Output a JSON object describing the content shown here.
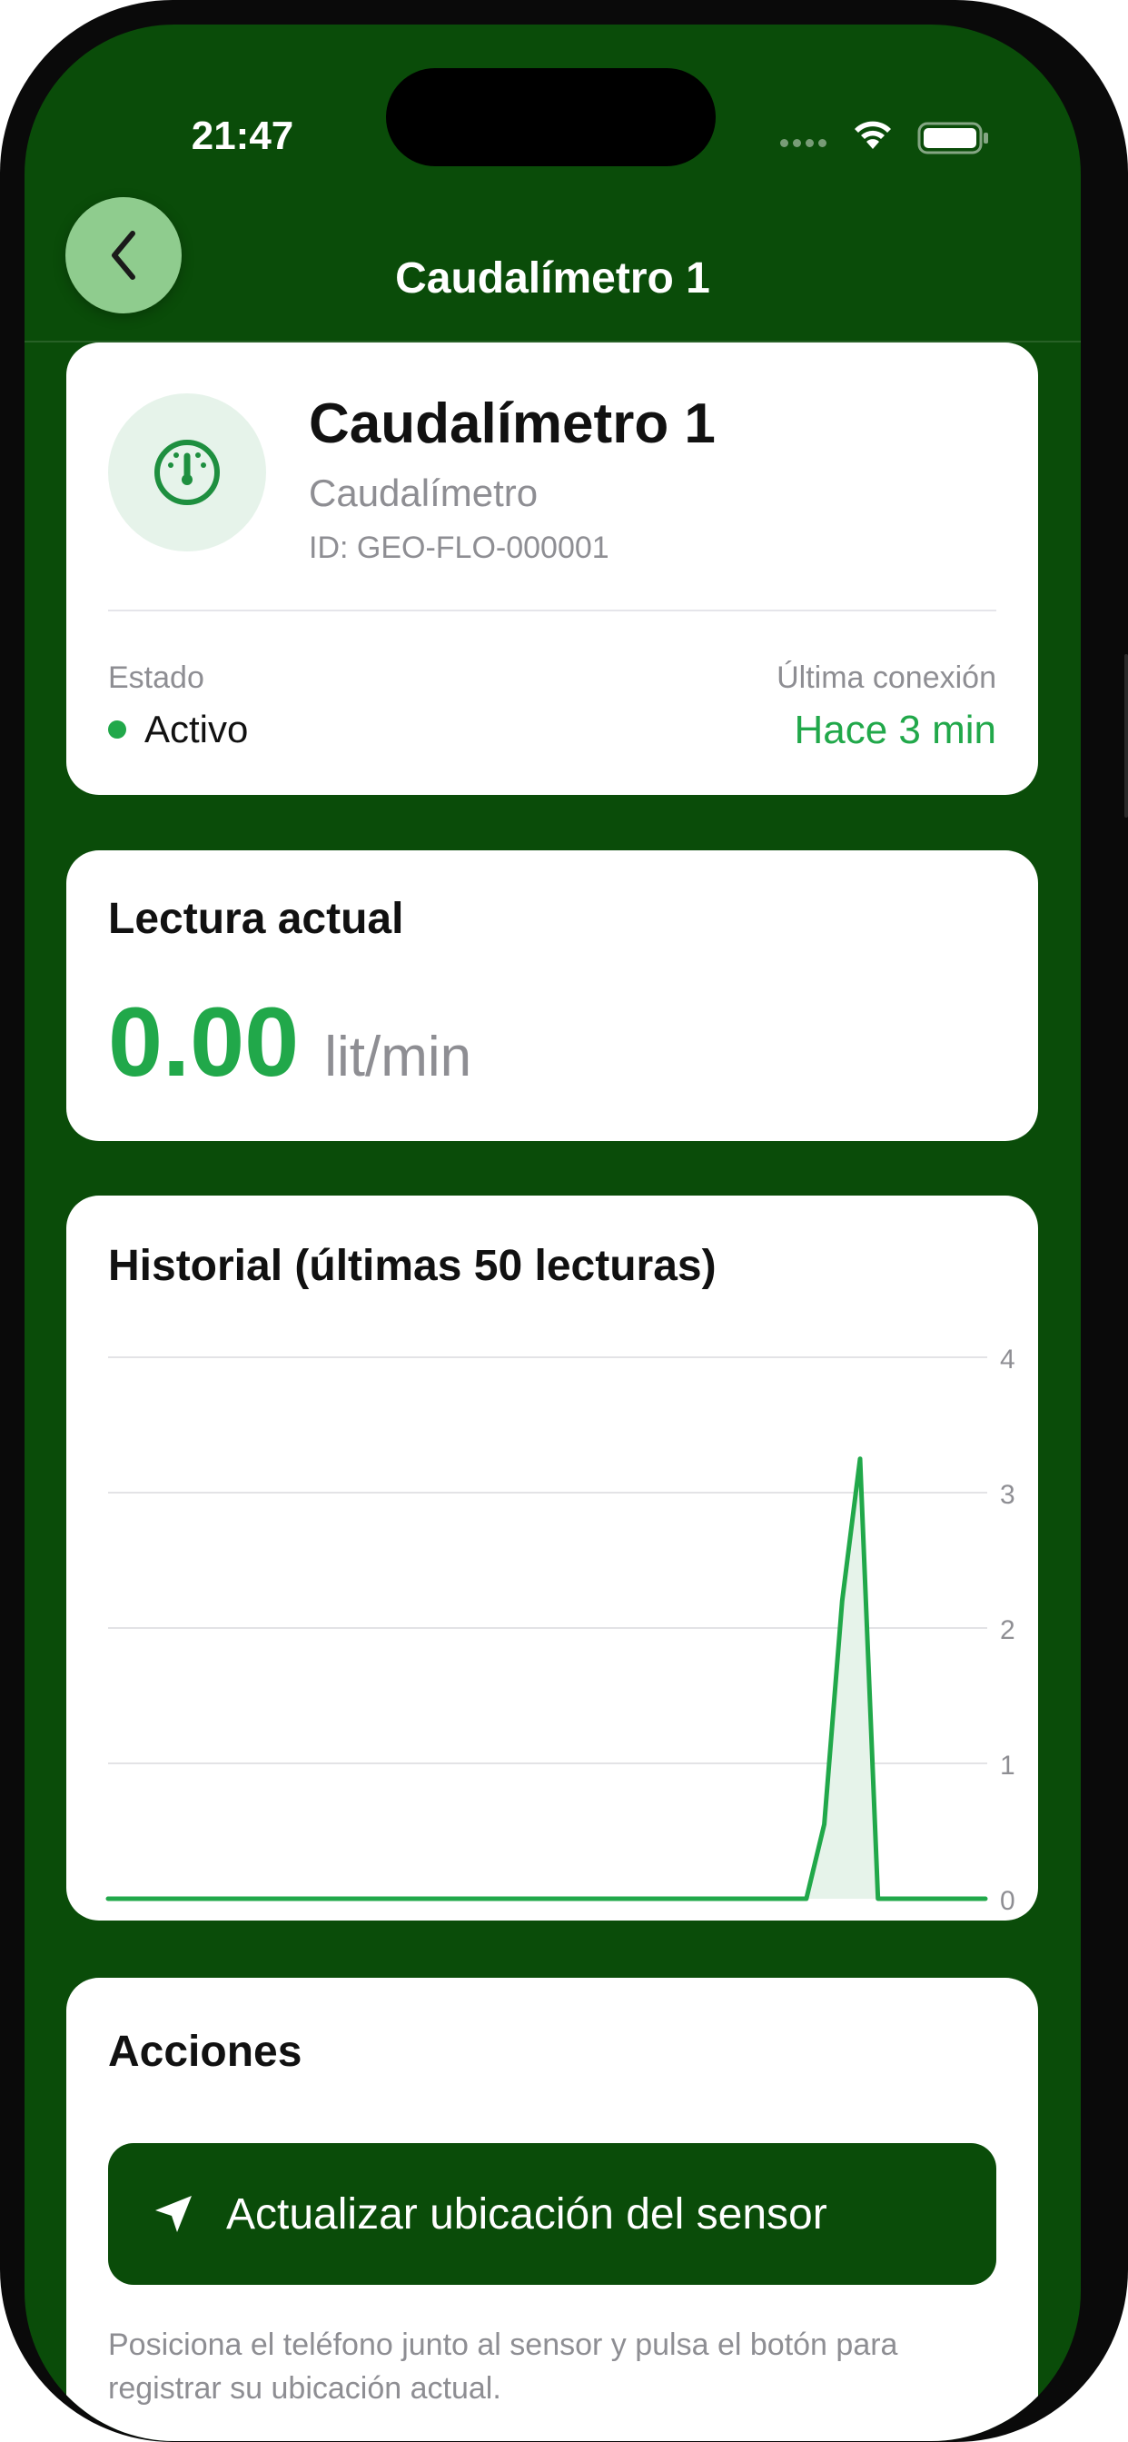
{
  "status_bar": {
    "time": "21:47"
  },
  "nav": {
    "title": "Caudalímetro 1",
    "back_icon": "chevron-left-icon"
  },
  "sensor": {
    "name": "Caudalímetro 1",
    "type": "Caudalímetro",
    "id": "ID: GEO-FLO-000001",
    "icon": "gauge-icon",
    "status_label": "Estado",
    "status_value": "Activo",
    "status_color": "#21a84a",
    "last_conn_label": "Última conexión",
    "last_conn_value": "Hace 3 min"
  },
  "reading": {
    "title": "Lectura actual",
    "value": "0.00",
    "unit": "lit/min"
  },
  "history": {
    "title": "Historial (últimas 50 lecturas)"
  },
  "chart_data": {
    "type": "area",
    "x": [
      1,
      2,
      3,
      4,
      5,
      6,
      7,
      8,
      9,
      10,
      11,
      12,
      13,
      14,
      15,
      16,
      17,
      18,
      19,
      20,
      21,
      22,
      23,
      24,
      25,
      26,
      27,
      28,
      29,
      30,
      31,
      32,
      33,
      34,
      35,
      36,
      37,
      38,
      39,
      40,
      41,
      42,
      43,
      44,
      45,
      46,
      47,
      48,
      49,
      50
    ],
    "values": [
      0,
      0,
      0,
      0,
      0,
      0,
      0,
      0,
      0,
      0,
      0,
      0,
      0,
      0,
      0,
      0,
      0,
      0,
      0,
      0,
      0,
      0,
      0,
      0,
      0,
      0,
      0,
      0,
      0,
      0,
      0,
      0,
      0,
      0,
      0,
      0,
      0,
      0,
      0,
      0,
      0.55,
      2.2,
      3.25,
      0,
      0,
      0,
      0,
      0,
      0,
      0
    ],
    "ylim": [
      0,
      4
    ],
    "yticks": [
      "0",
      "1",
      "2",
      "3",
      "4"
    ],
    "grid": true,
    "line_color": "#21a84a",
    "fill_color": "#e6f3ea"
  },
  "actions": {
    "title": "Acciones",
    "button_label": "Actualizar ubicación del sensor",
    "button_icon": "location-arrow-icon",
    "hint": "Posiciona el teléfono junto al sensor y pulsa el botón para registrar su ubicación actual."
  },
  "colors": {
    "header_green": "#0a4c09",
    "accent_green": "#21a84a",
    "back_button": "#8fcc8e"
  }
}
